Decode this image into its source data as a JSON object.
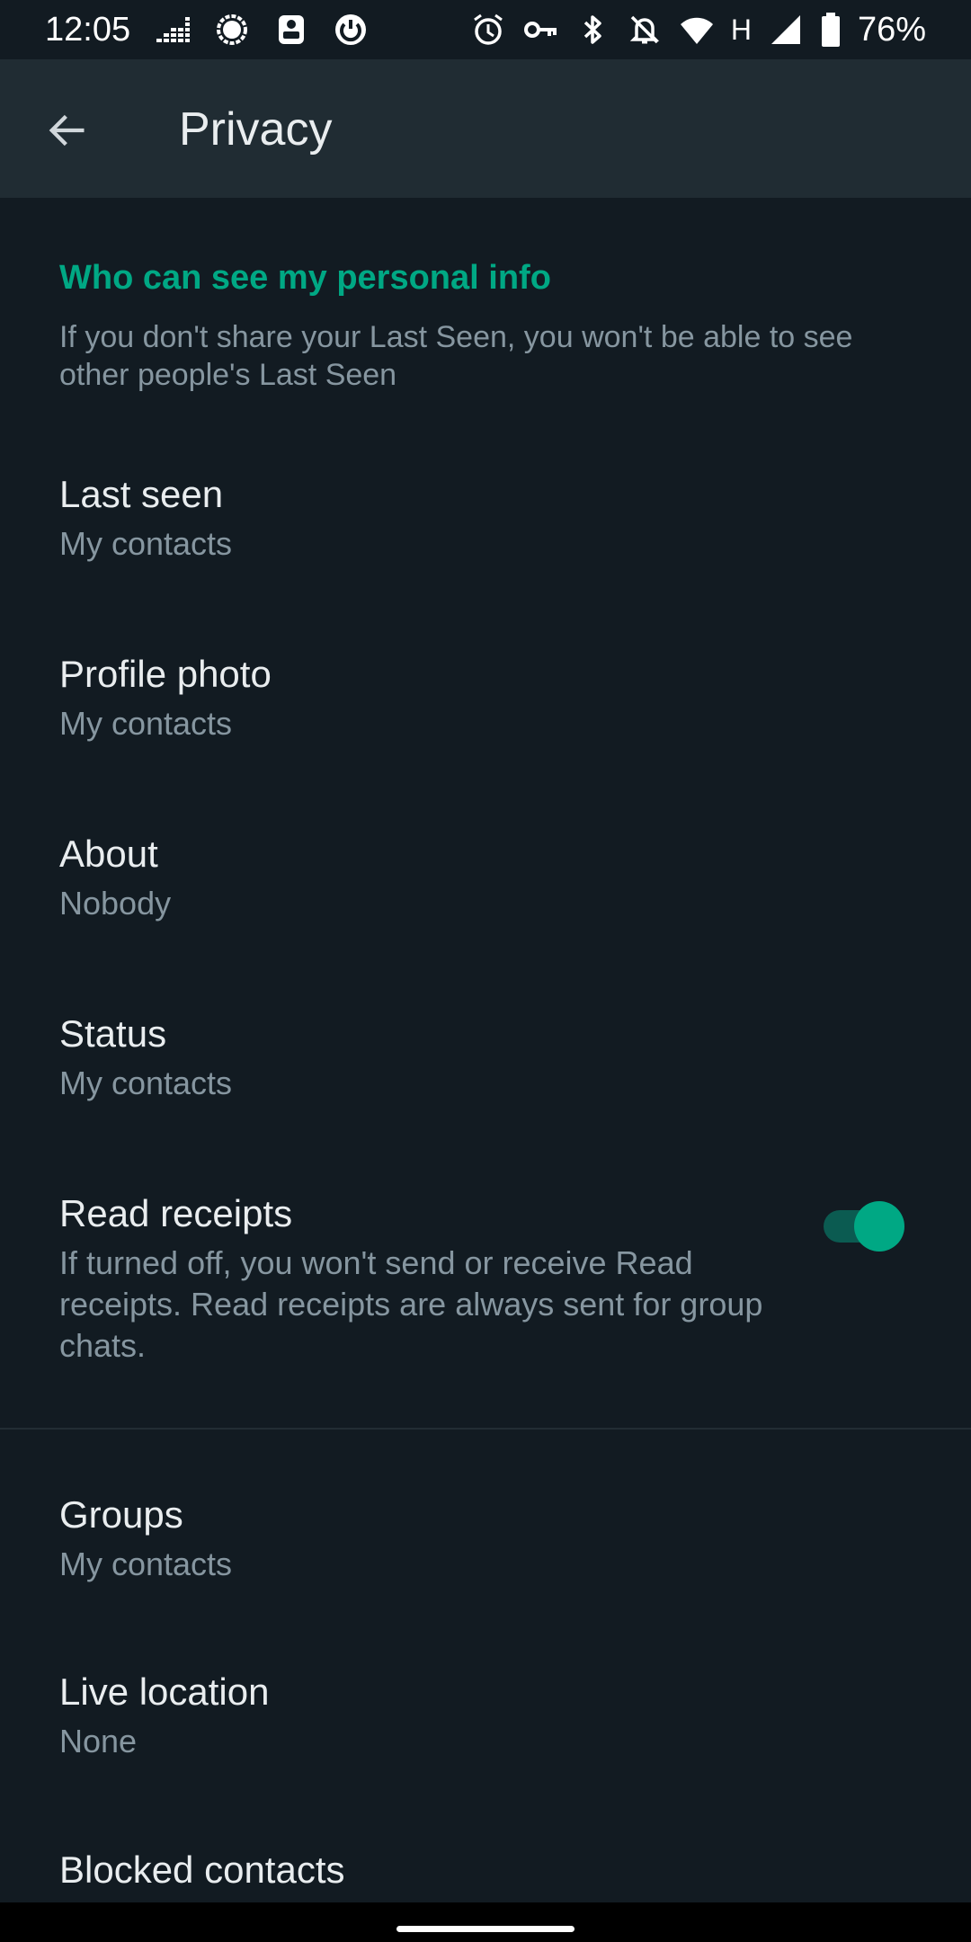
{
  "status_bar": {
    "time": "12:05",
    "network": "H",
    "battery": "76%",
    "left_icons": [
      "deezer-icon",
      "signal-icon",
      "vpn-lock-icon",
      "sync-icon"
    ],
    "right_icons": [
      "alarm-icon",
      "key-icon",
      "bluetooth-icon",
      "notifications-off-icon",
      "wifi-icon",
      "cell-signal-icon",
      "battery-icon"
    ]
  },
  "app_bar": {
    "title": "Privacy",
    "back_icon": "arrow-back-icon"
  },
  "section": {
    "header": "Who can see my personal info",
    "description": "If you don't share your Last Seen, you won't be able to see other people's Last Seen"
  },
  "settings": [
    {
      "title": "Last seen",
      "value": "My contacts"
    },
    {
      "title": "Profile photo",
      "value": "My contacts"
    },
    {
      "title": "About",
      "value": "Nobody"
    },
    {
      "title": "Status",
      "value": "My contacts"
    }
  ],
  "read_receipts": {
    "title": "Read receipts",
    "description": "If turned off, you won't send or receive Read receipts. Read receipts are always sent for group chats.",
    "enabled": true
  },
  "more_settings": [
    {
      "title": "Groups",
      "value": "My contacts"
    },
    {
      "title": "Live location",
      "value": "None"
    },
    {
      "title": "Blocked contacts"
    }
  ],
  "colors": {
    "background": "#121b22",
    "app_bar": "#202c33",
    "accent": "#00a884",
    "primary_text": "#e9edef",
    "secondary_text": "#8696a0"
  }
}
